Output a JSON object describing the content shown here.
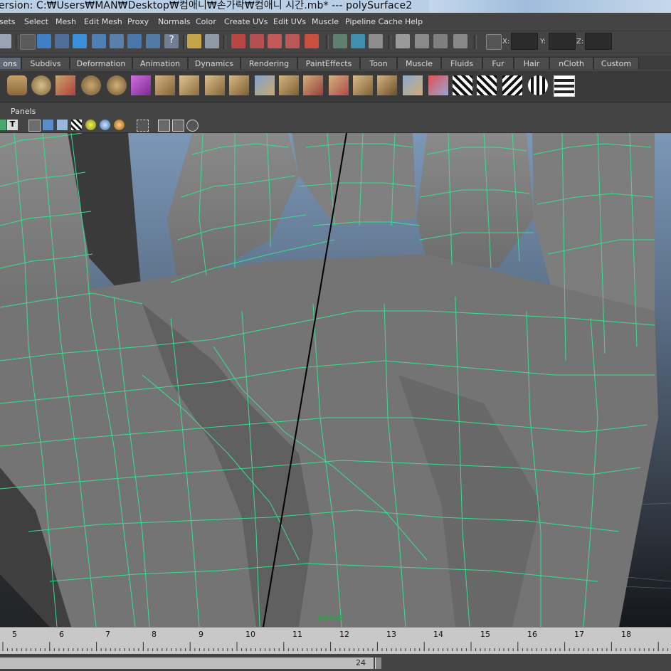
{
  "window": {
    "title": "ersion: C:₩Users₩MAN₩Desktop₩컴애니₩손가락₩컴애니 시간.mb*   ---   polySurface2"
  },
  "menubar": {
    "items": [
      "sets",
      "Select",
      "Mesh",
      "Edit Mesh",
      "Proxy",
      "Normals",
      "Color",
      "Create UVs",
      "Edit UVs",
      "Muscle",
      "Pipeline Cache",
      "Help"
    ]
  },
  "statusline": {
    "x_label": "X:",
    "y_label": "Y:",
    "z_label": "Z:",
    "x_value": "",
    "y_value": "",
    "z_value": ""
  },
  "shelf_tabs": {
    "active_index": 0,
    "items": [
      "ons",
      "Subdivs",
      "Deformation",
      "Animation",
      "Dynamics",
      "Rendering",
      "PaintEffects",
      "Toon",
      "Muscle",
      "Fluids",
      "Fur",
      "Hair",
      "nCloth",
      "Custom"
    ]
  },
  "panel": {
    "menu_label": "Panels"
  },
  "viewport": {
    "camera_label": "persp",
    "wireframe_color": "#38e08f",
    "mesh_color": "#7a7a7a"
  },
  "timeline": {
    "ticks": [
      "5",
      "6",
      "7",
      "8",
      "9",
      "10",
      "11",
      "12",
      "13",
      "14",
      "15",
      "16",
      "17",
      "18"
    ],
    "range_end": "24"
  },
  "colors": {
    "ui_bg": "#444444",
    "timeline_bg": "#c8c8c8",
    "active_tab": "#5e6a76"
  }
}
